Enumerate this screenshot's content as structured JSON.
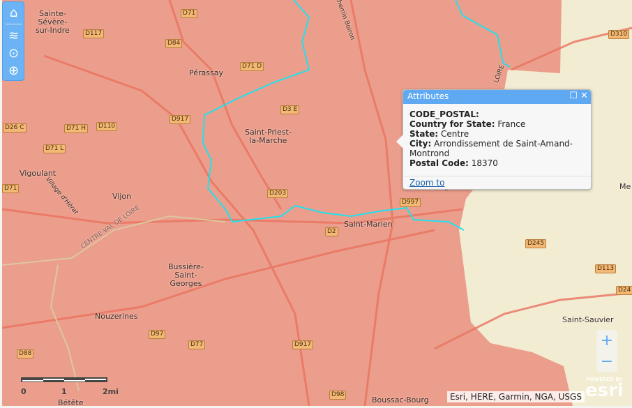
{
  "toolbar": {
    "items": [
      "home",
      "layers",
      "select",
      "basemap"
    ]
  },
  "labels": [
    "Sainte-\nSévère-\nsur-Indre",
    "Pérassay",
    "Saint-Priest-\nla-Marche",
    "Vigoulant",
    "Vijon",
    "Bussière-\nSaint-\nGeorges",
    "Nouzerines",
    "Saint-Marien",
    "Boussac-Bourg",
    "Saint-Sauvier",
    "Bétête",
    "Chemin Boiron",
    "Village d'Hérat",
    "CENTRE-VAL DE LOIRE",
    "Me",
    "LOIRE",
    "Prévéranges"
  ],
  "roads": [
    "D71",
    "D117",
    "D84",
    "D71 D",
    "D3 E",
    "D917",
    "D26 C",
    "D71 H",
    "D110",
    "D71 L",
    "D71",
    "D203",
    "D997",
    "D2",
    "D97",
    "D77",
    "D917",
    "D88",
    "D98",
    "D310",
    "D245",
    "D113",
    "D24"
  ],
  "popup": {
    "title": "Attributes",
    "fields": [
      {
        "label": "CODE_POSTAL:",
        "value": ""
      },
      {
        "label": "Country for State:",
        "value": "France"
      },
      {
        "label": "State:",
        "value": "Centre"
      },
      {
        "label": "City:",
        "value": "Arrondissement de Saint-Amand-Montrond"
      },
      {
        "label": "Postal Code:",
        "value": "18370"
      }
    ],
    "zoom_link": "Zoom to"
  },
  "zoom": {
    "in": "+",
    "out": "−"
  },
  "scale": {
    "ticks": [
      "0",
      "1",
      "2mi"
    ]
  },
  "attribution": "Esri, HERE, Garmin, NGA, USGS",
  "logo": {
    "powered": "POWERED BY",
    "brand": "esri"
  },
  "colors": {
    "selected_region": "#ec9e8c",
    "other_region": "#f2ecd2",
    "boundary": "#22e0ee",
    "accent": "#5fa9f3"
  }
}
